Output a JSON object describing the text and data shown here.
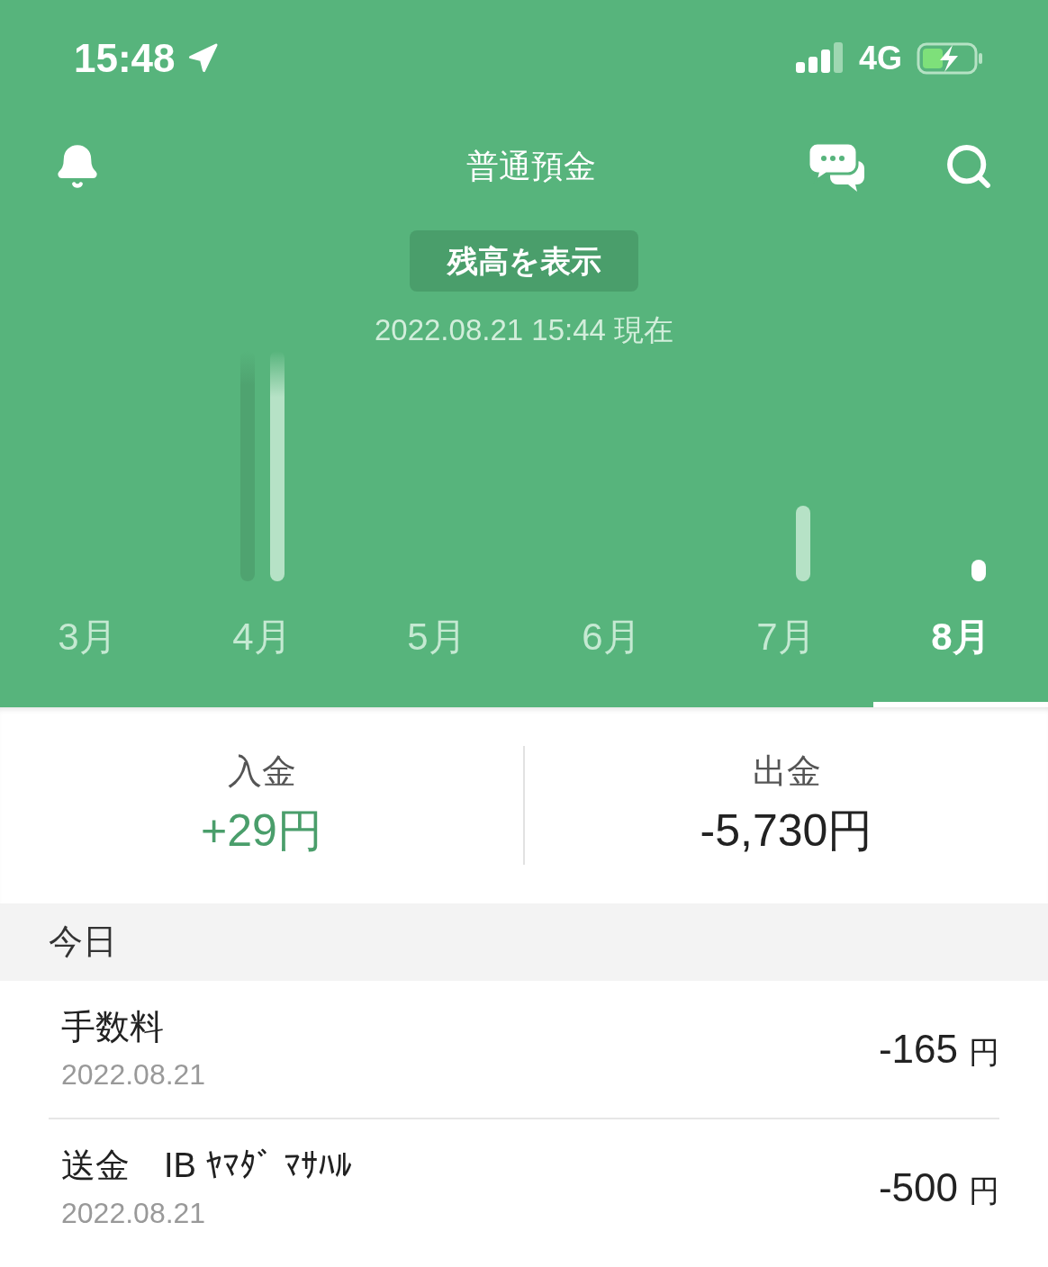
{
  "status_bar": {
    "time": "15:48",
    "network": "4G"
  },
  "header": {
    "title": "普通預金",
    "balance_button": "残高を表示",
    "timestamp": "2022.08.21 15:44 現在"
  },
  "months": [
    {
      "label": "3月",
      "selected": false
    },
    {
      "label": "4月",
      "selected": false
    },
    {
      "label": "5月",
      "selected": false
    },
    {
      "label": "6月",
      "selected": false
    },
    {
      "label": "7月",
      "selected": false
    },
    {
      "label": "8月",
      "selected": true
    }
  ],
  "summary": [
    {
      "kind": "income",
      "label": "入金",
      "amount": "+29円"
    },
    {
      "kind": "expense",
      "label": "出金",
      "amount": "-5,730円"
    }
  ],
  "section": "今日",
  "transactions": [
    {
      "description": "手数料",
      "date": "2022.08.21",
      "amount": "-165",
      "currency": "円"
    },
    {
      "description": "送金　IB ﾔﾏﾀﾞ ﾏｻﾊﾙ",
      "date": "2022.08.21",
      "amount": "-500",
      "currency": "円"
    }
  ]
}
